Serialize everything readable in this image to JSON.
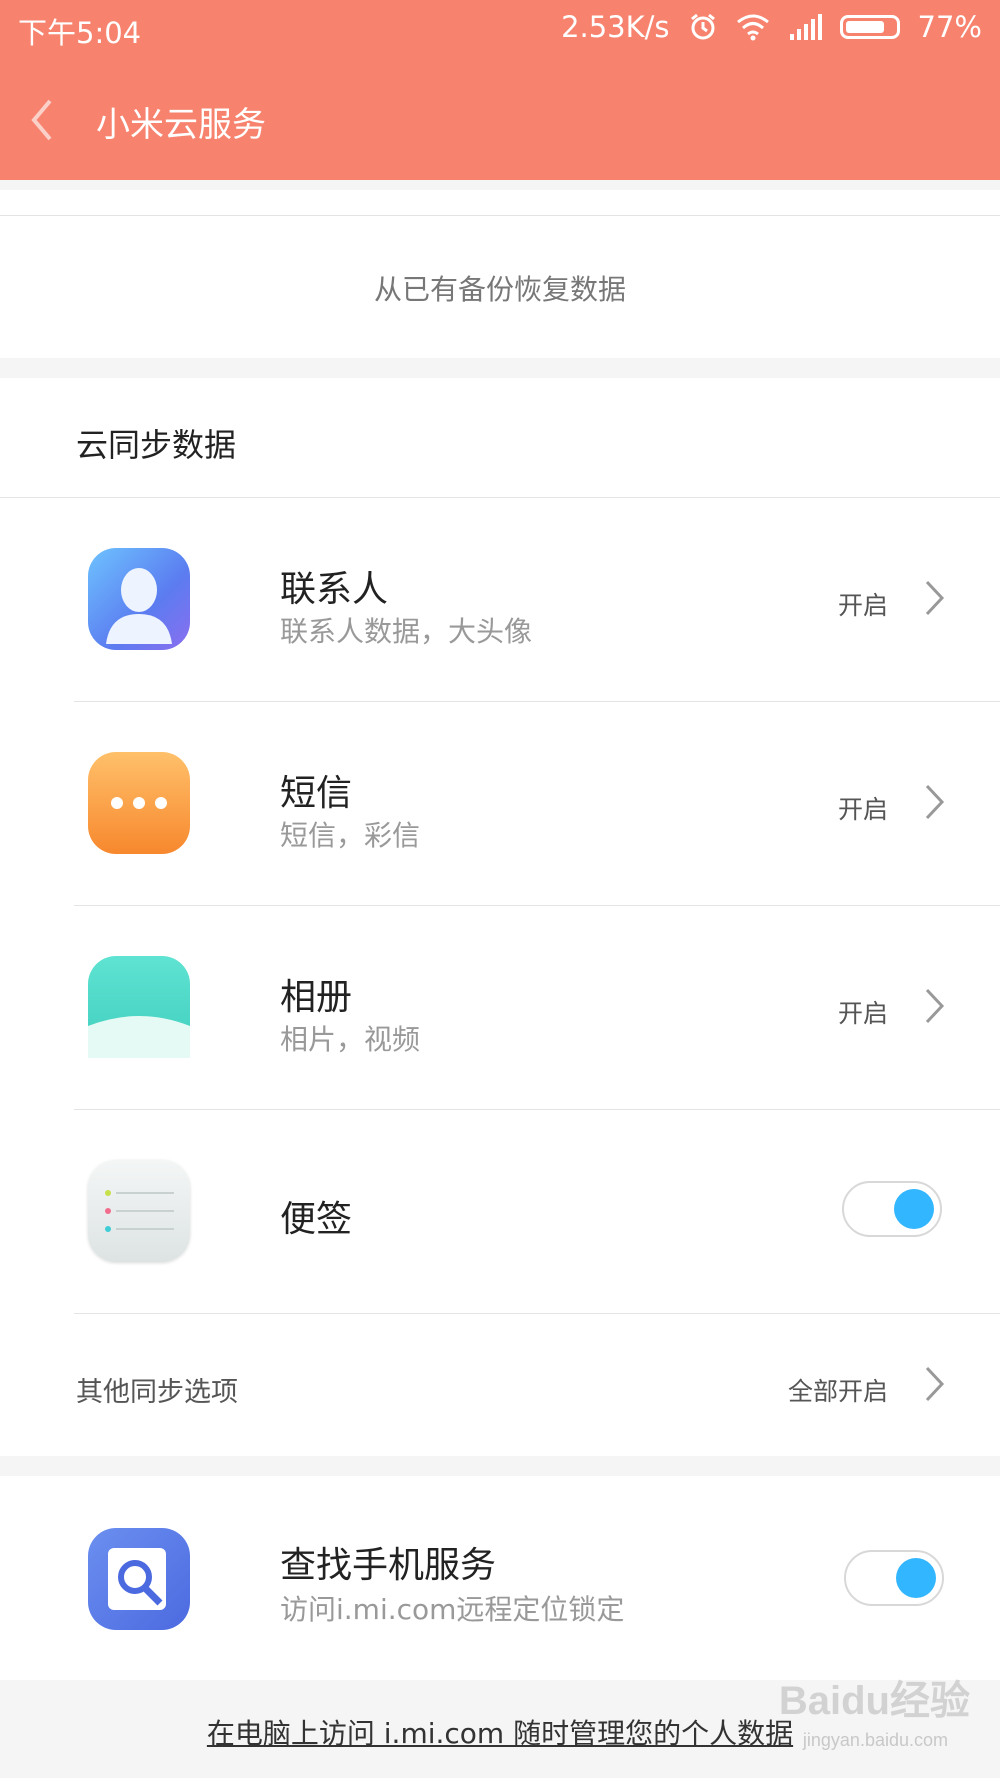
{
  "status_bar": {
    "time": "下午5:04",
    "speed": "2.53K/s",
    "battery": "77%"
  },
  "header": {
    "title": "小米云服务"
  },
  "restore": {
    "label": "从已有备份恢复数据"
  },
  "sync_section": {
    "title": "云同步数据",
    "items": [
      {
        "title": "联系人",
        "subtitle": "联系人数据，大头像",
        "status": "开启",
        "icon": "contacts-icon"
      },
      {
        "title": "短信",
        "subtitle": "短信，彩信",
        "status": "开启",
        "icon": "sms-icon"
      },
      {
        "title": "相册",
        "subtitle": "相片，视频",
        "status": "开启",
        "icon": "gallery-icon"
      },
      {
        "title": "便签",
        "icon": "notes-icon",
        "toggle": "on"
      }
    ],
    "other": {
      "label": "其他同步选项",
      "status": "全部开启"
    }
  },
  "find_phone": {
    "title": "查找手机服务",
    "subtitle": "访问i.mi.com远程定位锁定",
    "icon": "find-phone-icon",
    "toggle": "on"
  },
  "footer": {
    "link": "在电脑上访问 i.mi.com 随时管理您的个人数据"
  },
  "watermark": {
    "brand": "Baidu经验",
    "url": "jingyan.baidu.com"
  },
  "colors": {
    "header": "#f7836f",
    "toggle_on": "#32b6ff"
  }
}
